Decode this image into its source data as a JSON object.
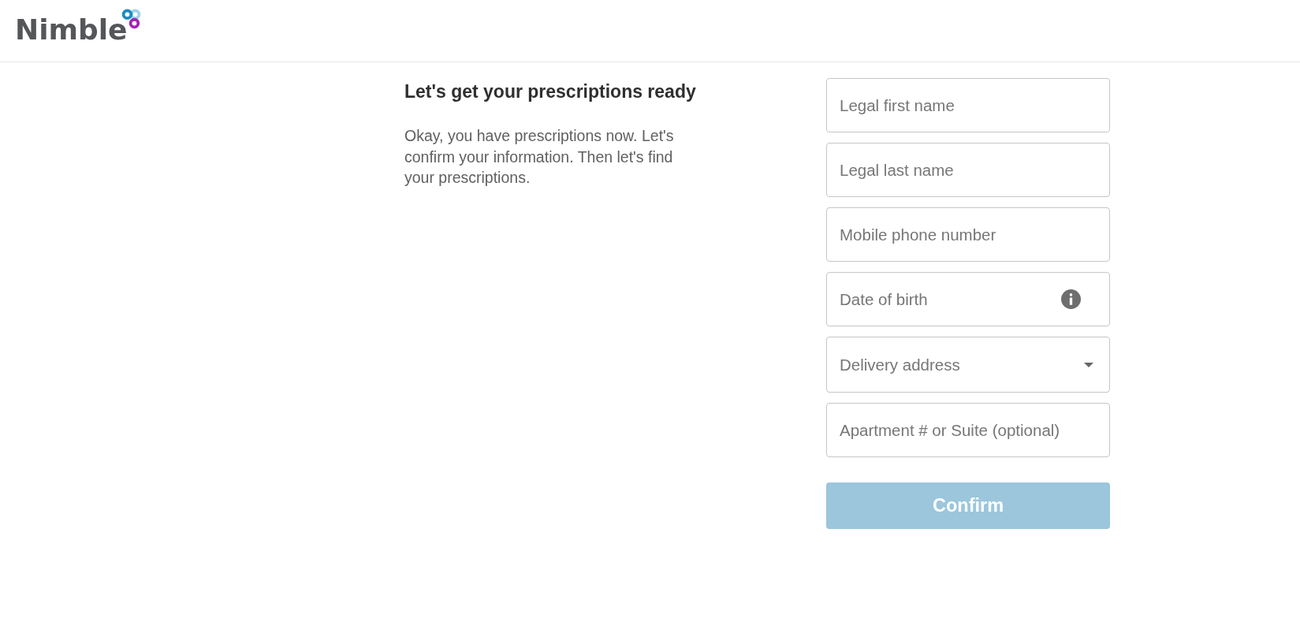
{
  "header": {
    "brand": "Nimble"
  },
  "intro": {
    "heading": "Let's get your prescriptions ready",
    "body": "Okay, you have prescriptions now. Let's confirm your information. Then let's find your prescriptions."
  },
  "form": {
    "fields": [
      {
        "kind": "text",
        "placeholder": "Legal first name"
      },
      {
        "kind": "text",
        "placeholder": "Legal last name"
      },
      {
        "kind": "text",
        "placeholder": "Mobile phone number"
      },
      {
        "kind": "date",
        "placeholder": "Date of birth"
      },
      {
        "kind": "select",
        "placeholder": "Delivery address"
      },
      {
        "kind": "text",
        "placeholder": "Apartment # or Suite (optional)"
      }
    ],
    "submit": {
      "label": "Confirm",
      "disabled": true
    }
  }
}
